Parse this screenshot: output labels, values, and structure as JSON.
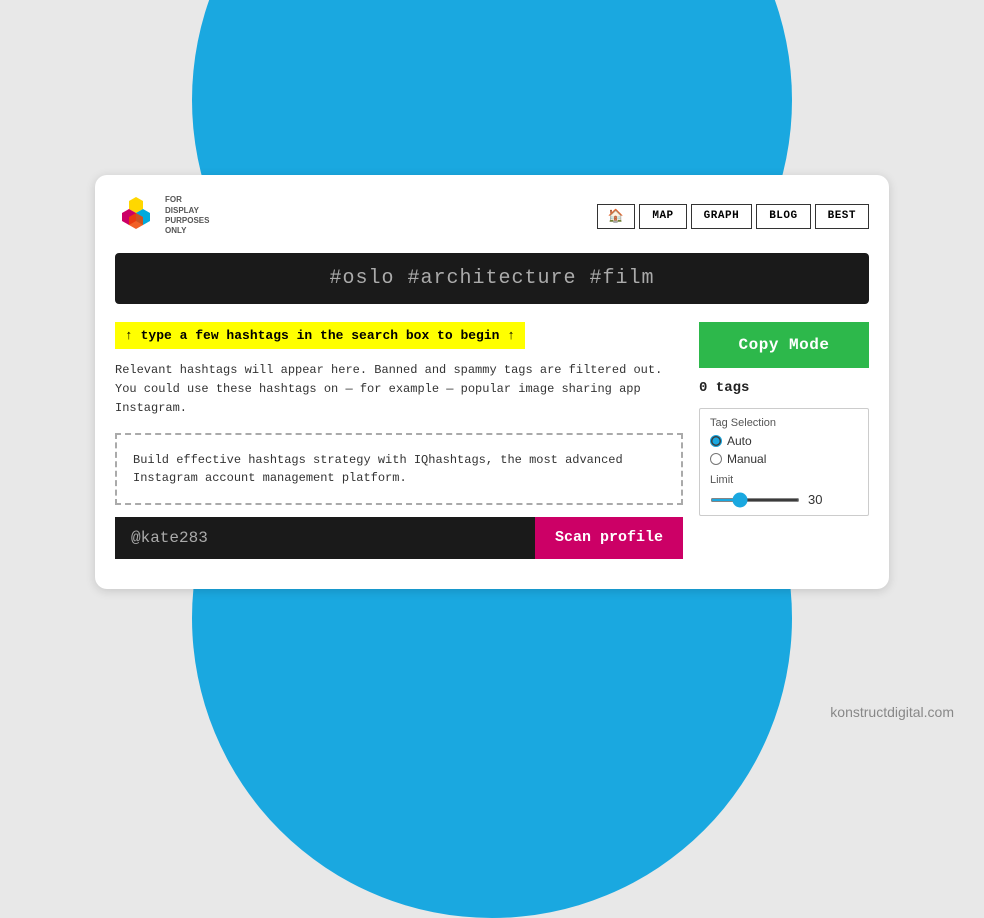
{
  "background": {
    "circle_color": "#1aa8e0"
  },
  "header": {
    "logo_text_line1": "FOR",
    "logo_text_line2": "DISPLAY",
    "logo_text_line3": "PURPOSES",
    "logo_text_line4": "ONLY",
    "nav": {
      "home_icon": "🏠",
      "items": [
        {
          "label": "MAP"
        },
        {
          "label": "GRAPH"
        },
        {
          "label": "BLOG"
        },
        {
          "label": "BEST"
        }
      ]
    }
  },
  "search_bar": {
    "placeholder": "#oslo #architecture #film"
  },
  "hint": {
    "text": "↑ type a few hashtags in the search box to begin ↑"
  },
  "description": {
    "text": "Relevant hashtags will appear here. Banned and spammy tags are filtered out. You could use these hashtags on — for example — popular image sharing app Instagram."
  },
  "promo": {
    "text": "Build effective hashtags strategy with IQhashtags, the most advanced Instagram account management platform."
  },
  "input": {
    "placeholder": "@kate283",
    "value": "@kate283"
  },
  "scan_button": {
    "label": "Scan profile"
  },
  "right_panel": {
    "copy_mode_label": "Copy Mode",
    "tags_count_label": "0 tags",
    "tag_selection_label": "Tag Selection",
    "radio_options": [
      {
        "label": "Auto",
        "checked": true
      },
      {
        "label": "Manual",
        "checked": false
      }
    ],
    "limit_label": "Limit",
    "limit_value": "30",
    "slider_min": 0,
    "slider_max": 100,
    "slider_current": 30
  },
  "footer": {
    "text": "konstructdigital.com"
  }
}
